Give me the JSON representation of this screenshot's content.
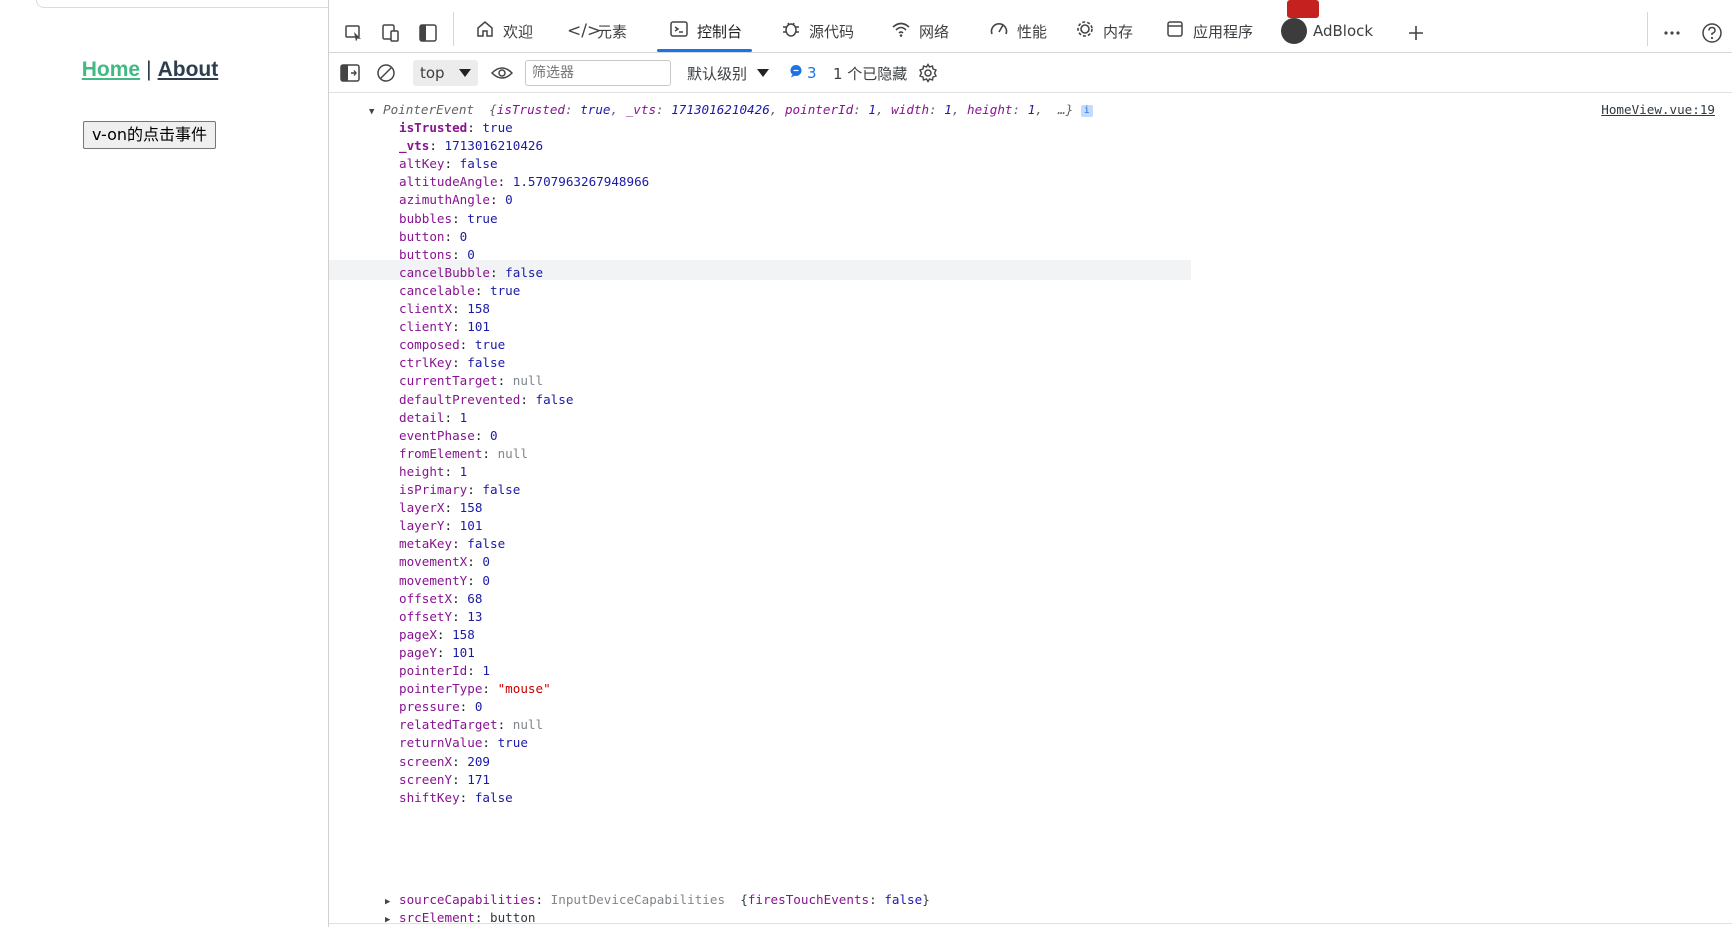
{
  "app": {
    "nav": {
      "home": "Home",
      "separator": "|",
      "about": "About"
    },
    "button_label": "v-on的点击事件"
  },
  "devtools": {
    "tabs": [
      {
        "label": "欢迎",
        "icon": "home-icon"
      },
      {
        "label": "元素",
        "icon": "code-icon"
      },
      {
        "label": "控制台",
        "icon": "console-icon",
        "active": true
      },
      {
        "label": "源代码",
        "icon": "bug-icon"
      },
      {
        "label": "网络",
        "icon": "wifi-icon"
      },
      {
        "label": "性能",
        "icon": "gauge-icon"
      },
      {
        "label": "内存",
        "icon": "chip-icon"
      },
      {
        "label": "应用程序",
        "icon": "window-icon"
      },
      {
        "label": "AdBlock",
        "icon": "adblock-icon"
      }
    ],
    "toolbar": {
      "context": "top",
      "filter_placeholder": "筛选器",
      "level": "默认级别",
      "message_count": "3",
      "hidden": "1 个已隐藏"
    },
    "console": {
      "source_link": "HomeView.vue:19",
      "header": {
        "type": "PointerEvent",
        "preview_open": "{",
        "preview": [
          {
            "key": "isTrusted",
            "value": "true"
          },
          {
            "key": "_vts",
            "value": "1713016210426"
          },
          {
            "key": "pointerId",
            "value": "1"
          },
          {
            "key": "width",
            "value": "1"
          },
          {
            "key": "height",
            "value": "1"
          }
        ],
        "preview_tail": "…}",
        "info_badge": "i"
      },
      "properties": [
        {
          "key": "isTrusted",
          "value": "true",
          "kind": "bool",
          "bold": true
        },
        {
          "key": "_vts",
          "value": "1713016210426",
          "kind": "num",
          "bold": true
        },
        {
          "key": "altKey",
          "value": "false",
          "kind": "bool"
        },
        {
          "key": "altitudeAngle",
          "value": "1.5707963267948966",
          "kind": "num"
        },
        {
          "key": "azimuthAngle",
          "value": "0",
          "kind": "num"
        },
        {
          "key": "bubbles",
          "value": "true",
          "kind": "bool"
        },
        {
          "key": "button",
          "value": "0",
          "kind": "num"
        },
        {
          "key": "buttons",
          "value": "0",
          "kind": "num"
        },
        {
          "key": "cancelBubble",
          "value": "false",
          "kind": "bool"
        },
        {
          "key": "cancelable",
          "value": "true",
          "kind": "bool"
        },
        {
          "key": "clientX",
          "value": "158",
          "kind": "num"
        },
        {
          "key": "clientY",
          "value": "101",
          "kind": "num"
        },
        {
          "key": "composed",
          "value": "true",
          "kind": "bool"
        },
        {
          "key": "ctrlKey",
          "value": "false",
          "kind": "bool"
        },
        {
          "key": "currentTarget",
          "value": "null",
          "kind": "null"
        },
        {
          "key": "defaultPrevented",
          "value": "false",
          "kind": "bool"
        },
        {
          "key": "detail",
          "value": "1",
          "kind": "num"
        },
        {
          "key": "eventPhase",
          "value": "0",
          "kind": "num"
        },
        {
          "key": "fromElement",
          "value": "null",
          "kind": "null"
        },
        {
          "key": "height",
          "value": "1",
          "kind": "num"
        },
        {
          "key": "isPrimary",
          "value": "false",
          "kind": "bool"
        },
        {
          "key": "layerX",
          "value": "158",
          "kind": "num"
        },
        {
          "key": "layerY",
          "value": "101",
          "kind": "num"
        },
        {
          "key": "metaKey",
          "value": "false",
          "kind": "bool"
        },
        {
          "key": "movementX",
          "value": "0",
          "kind": "num"
        },
        {
          "key": "movementY",
          "value": "0",
          "kind": "num"
        },
        {
          "key": "offsetX",
          "value": "68",
          "kind": "num"
        },
        {
          "key": "offsetY",
          "value": "13",
          "kind": "num"
        },
        {
          "key": "pageX",
          "value": "158",
          "kind": "num"
        },
        {
          "key": "pageY",
          "value": "101",
          "kind": "num"
        },
        {
          "key": "pointerId",
          "value": "1",
          "kind": "num"
        },
        {
          "key": "pointerType",
          "value": "\"mouse\"",
          "kind": "str"
        },
        {
          "key": "pressure",
          "value": "0",
          "kind": "num"
        },
        {
          "key": "relatedTarget",
          "value": "null",
          "kind": "null"
        },
        {
          "key": "returnValue",
          "value": "true",
          "kind": "bool"
        },
        {
          "key": "screenX",
          "value": "209",
          "kind": "num"
        },
        {
          "key": "screenY",
          "value": "171",
          "kind": "num"
        },
        {
          "key": "shiftKey",
          "value": "false",
          "kind": "bool"
        }
      ],
      "collapsed": [
        {
          "key": "sourceCapabilities",
          "class": "InputDeviceCapabilities",
          "preview_key": "firesTouchEvents",
          "preview_value": "false"
        },
        {
          "key": "srcElement",
          "value": "button"
        }
      ]
    }
  },
  "colors": {
    "home_link": "#42b983",
    "about_link": "#2c3e50",
    "active_tab_underline": "#1a73e8",
    "property_key": "#881391",
    "value_primitive": "#1a1aa6",
    "value_string": "#c80000",
    "value_null": "#80868b"
  }
}
